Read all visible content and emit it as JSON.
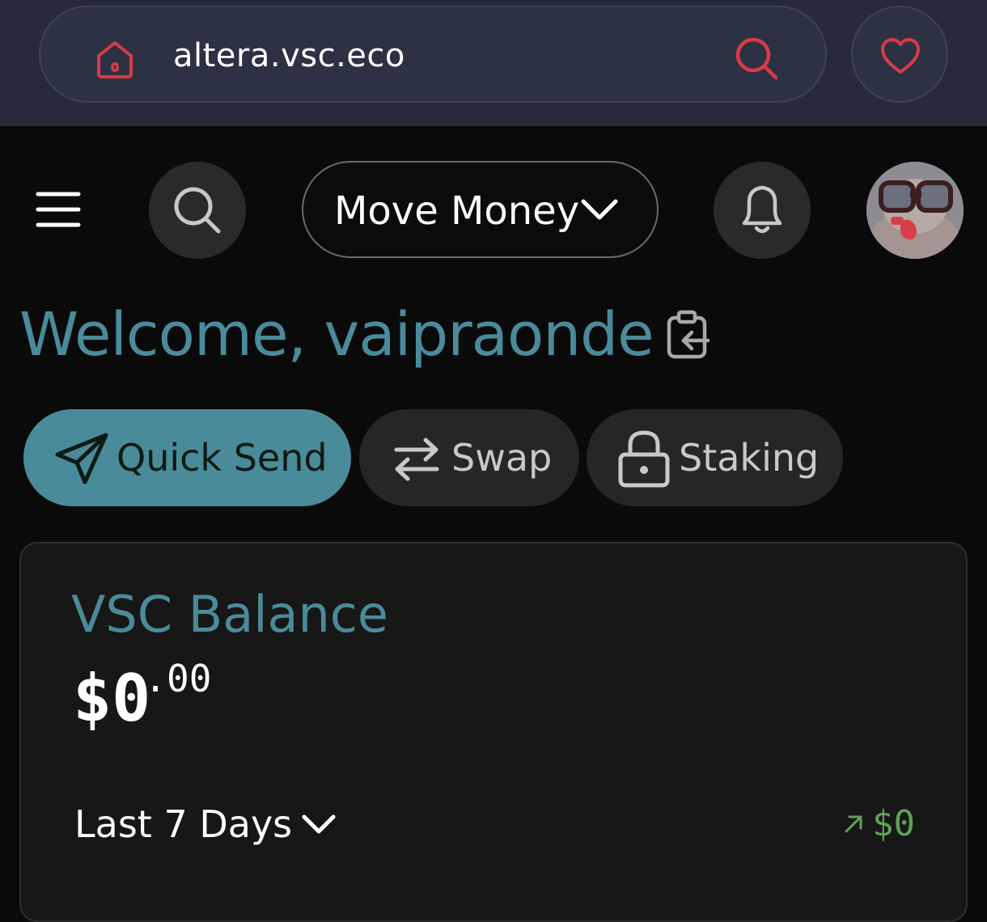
{
  "browser": {
    "url": "altera.vsc.eco",
    "icons": {
      "home": "home-icon",
      "search": "search-icon",
      "favorite": "heart-icon"
    },
    "accent_color": "#d93b45"
  },
  "header": {
    "menu_icon": "hamburger-menu-icon",
    "search_icon": "search-icon",
    "move_money_label": "Move Money",
    "notifications_icon": "bell-icon",
    "avatar_icon": "user-avatar"
  },
  "welcome": {
    "text": "Welcome, vaipraonde",
    "copy_icon": "clipboard-icon"
  },
  "actions": [
    {
      "label": "Quick Send",
      "icon": "send-icon"
    },
    {
      "label": "Swap",
      "icon": "swap-arrows-icon"
    },
    {
      "label": "Staking",
      "icon": "lock-icon"
    }
  ],
  "balance_card": {
    "title": "VSC Balance",
    "amount_main": "$0",
    "amount_cents": ".00",
    "period_label": "Last 7 Days",
    "change_value": "$0",
    "change_color": "#5fa157"
  },
  "colors": {
    "brand": "#4a8b9a",
    "background": "#0a0a0a",
    "card": "#171717"
  }
}
